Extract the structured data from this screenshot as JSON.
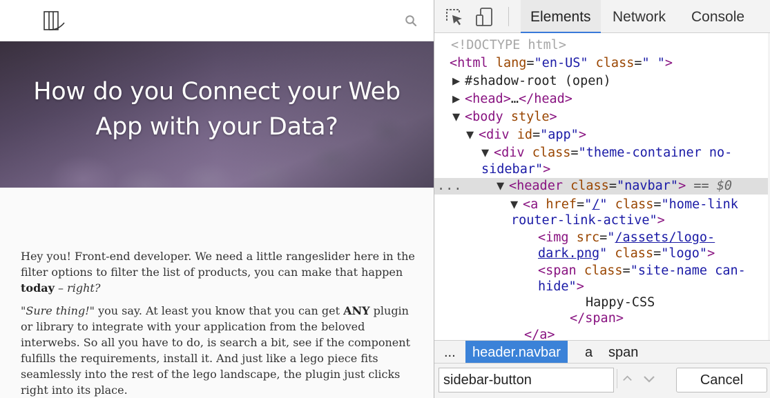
{
  "page": {
    "hero_title_line1": "How do you Connect your Web",
    "hero_title_line2": "App with your Data?",
    "article": {
      "p1_a": "Hey you! Front-end developer. We need a little rangeslider here in the filter options to filter the list of products, you can make that happen ",
      "p1_bold": "today",
      "p1_b": " – ",
      "p1_italic": "right?",
      "p2_italic": "\"Sure thing!\"",
      "p2_a": " you say. At least you know that you can get ",
      "p2_bold": "ANY",
      "p2_b": " plugin or library to integrate with your application from the beloved interwebs. So all you have to do, is search a bit, see if the component fulfills the requirements, install it. And just like a lego piece fits seamlessly into the rest of the lego landscape, the plugin just clicks right into its place."
    },
    "icons": {
      "logo": "logo-icon",
      "search": "search-icon"
    }
  },
  "devtools": {
    "tabs": {
      "elements": "Elements",
      "network": "Network",
      "console": "Console"
    },
    "icons": {
      "inspect": "inspect-element-icon",
      "device": "device-toolbar-icon"
    },
    "tree": {
      "doctype": "<!DOCTYPE html>",
      "html_tag_open": "<html",
      "html_attr1_name": "lang",
      "html_attr1_val": "\"en-US\"",
      "html_attr2_name": "class",
      "html_attr2_val": "\" \"",
      "html_tag_close": ">",
      "shadow_root": "#shadow-root (open)",
      "head_open": "<head>",
      "head_ellipsis": "…",
      "head_close": "</head>",
      "body_open": "<body",
      "body_attr": "style",
      "body_close": ">",
      "div_app_open": "<div",
      "div_app_attr": "id",
      "div_app_val": "\"app\"",
      "div_app_close": ">",
      "div_theme_open": "<div",
      "div_theme_attr": "class",
      "div_theme_val1": "\"theme-container no-",
      "div_theme_val2": "sidebar\"",
      "div_theme_close": ">",
      "header_open": "<header",
      "header_attr": "class",
      "header_val": "\"navbar\"",
      "header_close": ">",
      "header_eq": "==",
      "header_var": "$0",
      "a_open": "<a",
      "a_attr1": "href",
      "a_val1": "/",
      "a_attr2": "class",
      "a_val2_1": "\"home-link",
      "a_val2_2": "router-link-active\"",
      "a_close": ">",
      "img_open": "<img",
      "img_attr1": "src",
      "img_val1_1": "/assets/logo-",
      "img_val1_2": "dark.png",
      "img_attr2": "class",
      "img_val2": "\"logo\"",
      "img_close": ">",
      "span_open": "<span",
      "span_attr": "class",
      "span_val1": "\"site-name can-",
      "span_val2": "hide\"",
      "span_close": ">",
      "span_text": "Happy-CSS",
      "span_end": "</span>",
      "a_end": "</a>",
      "gutter_ellipsis": "..."
    },
    "breadcrumbs": {
      "more": "...",
      "header": "header.navbar",
      "a": "a",
      "span": "span"
    },
    "search": {
      "value": "sidebar-button",
      "cancel": "Cancel"
    }
  },
  "colors": {
    "tag": "#881280",
    "attr_name": "#994500",
    "attr_value": "#1a1aa6",
    "selected_crumb": "#3b82d8",
    "active_tab_underline": "#3879d9"
  }
}
